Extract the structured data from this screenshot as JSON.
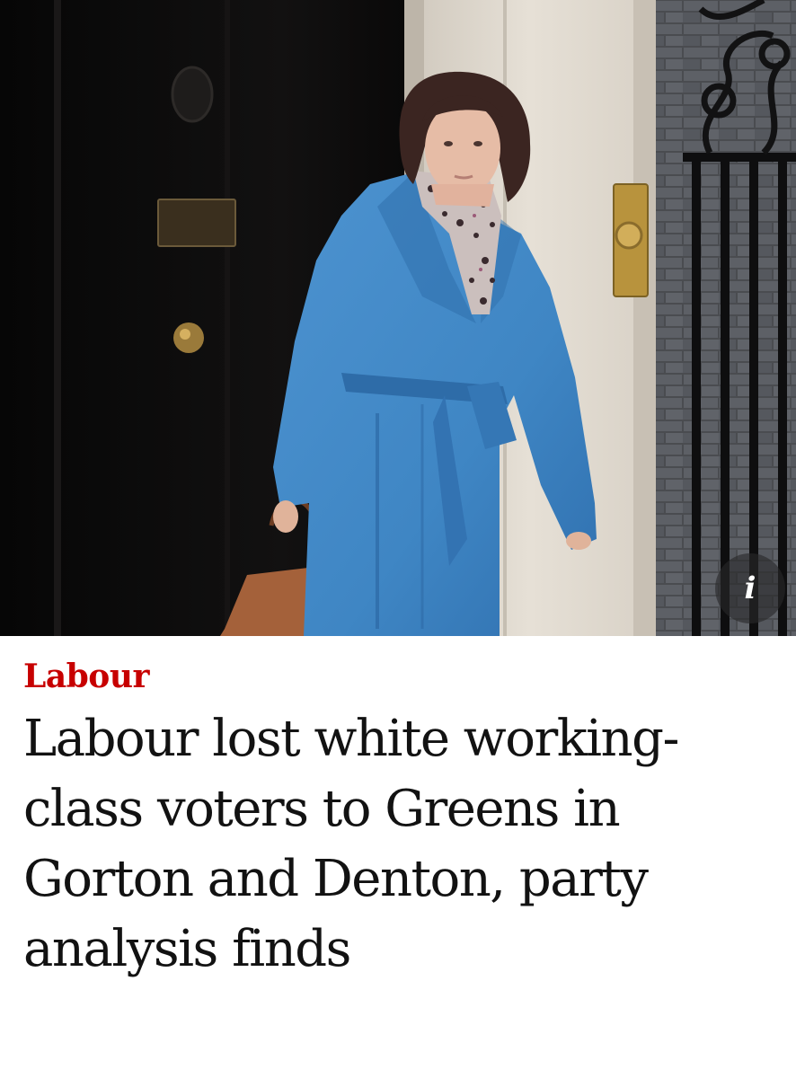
{
  "article": {
    "section": "Labour",
    "headline": "Labour lost white working-class voters to Greens in Gorton and Denton, party analysis finds"
  },
  "hero": {
    "info_label": "i",
    "info_icon": "info-icon"
  },
  "colors": {
    "kicker": "#c70000",
    "headline": "#121212",
    "coat": "#3f86c4"
  }
}
